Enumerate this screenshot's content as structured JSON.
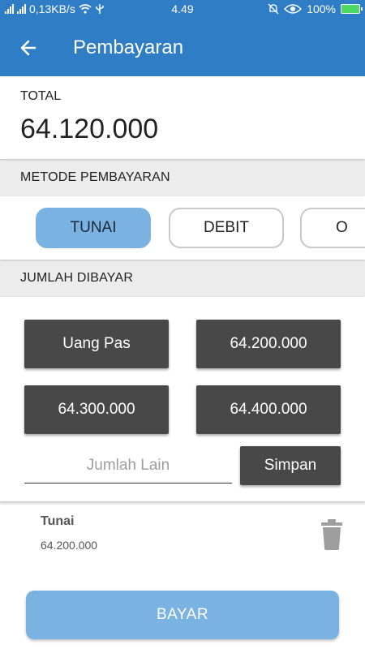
{
  "status_bar": {
    "network_speed": "0,13KB/s",
    "time": "4.49",
    "battery_percent": "100%"
  },
  "app_bar": {
    "title": "Pembayaran",
    "back_icon": "arrow-left-icon"
  },
  "total": {
    "label": "TOTAL",
    "value": "64.120.000"
  },
  "payment_method": {
    "label": "METODE PEMBAYARAN",
    "options": [
      {
        "label": "TUNAI",
        "selected": true
      },
      {
        "label": "DEBIT",
        "selected": false
      },
      {
        "label": "O",
        "selected": false
      }
    ]
  },
  "amount_paid": {
    "label": "JUMLAH DIBAYAR",
    "quick_amounts": [
      "Uang Pas",
      "64.200.000",
      "64.300.000",
      "64.400.000"
    ],
    "other_placeholder": "Jumlah Lain",
    "other_value": "",
    "save_label": "Simpan"
  },
  "payments": [
    {
      "method": "Tunai",
      "amount": "64.200.000",
      "delete_icon": "trash-icon"
    }
  ],
  "pay_button_label": "BAYAR",
  "colors": {
    "primary": "#2f7dc5",
    "accent_light": "#7ab3e1",
    "dark_button": "#484848",
    "background": "#ececec"
  }
}
